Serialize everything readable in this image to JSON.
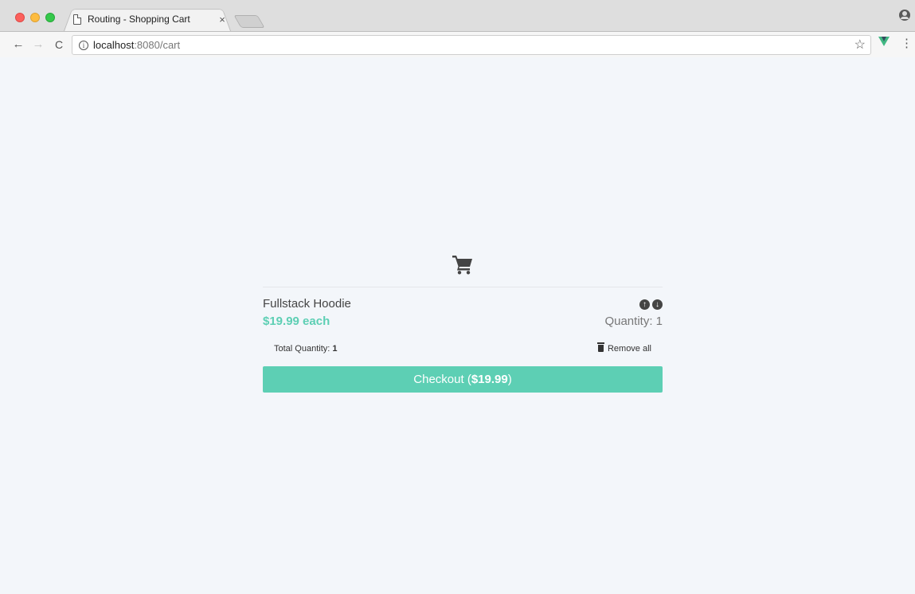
{
  "browser": {
    "tab_title": "Routing - Shopping Cart",
    "tab_close": "×",
    "url_host": "localhost",
    "url_rest": ":8080/cart"
  },
  "cart": {
    "item": {
      "title": "Fullstack Hoodie",
      "price": "$19.99 each",
      "quantity": "Quantity: 1"
    },
    "summary": {
      "total_label": "Total Quantity: ",
      "total_value": "1",
      "remove_all": "Remove all"
    },
    "checkout": {
      "label": "Checkout (",
      "amount": "$19.99",
      "suffix": ")"
    }
  },
  "colors": {
    "accent": "#5dcfb4",
    "text": "#444444"
  }
}
